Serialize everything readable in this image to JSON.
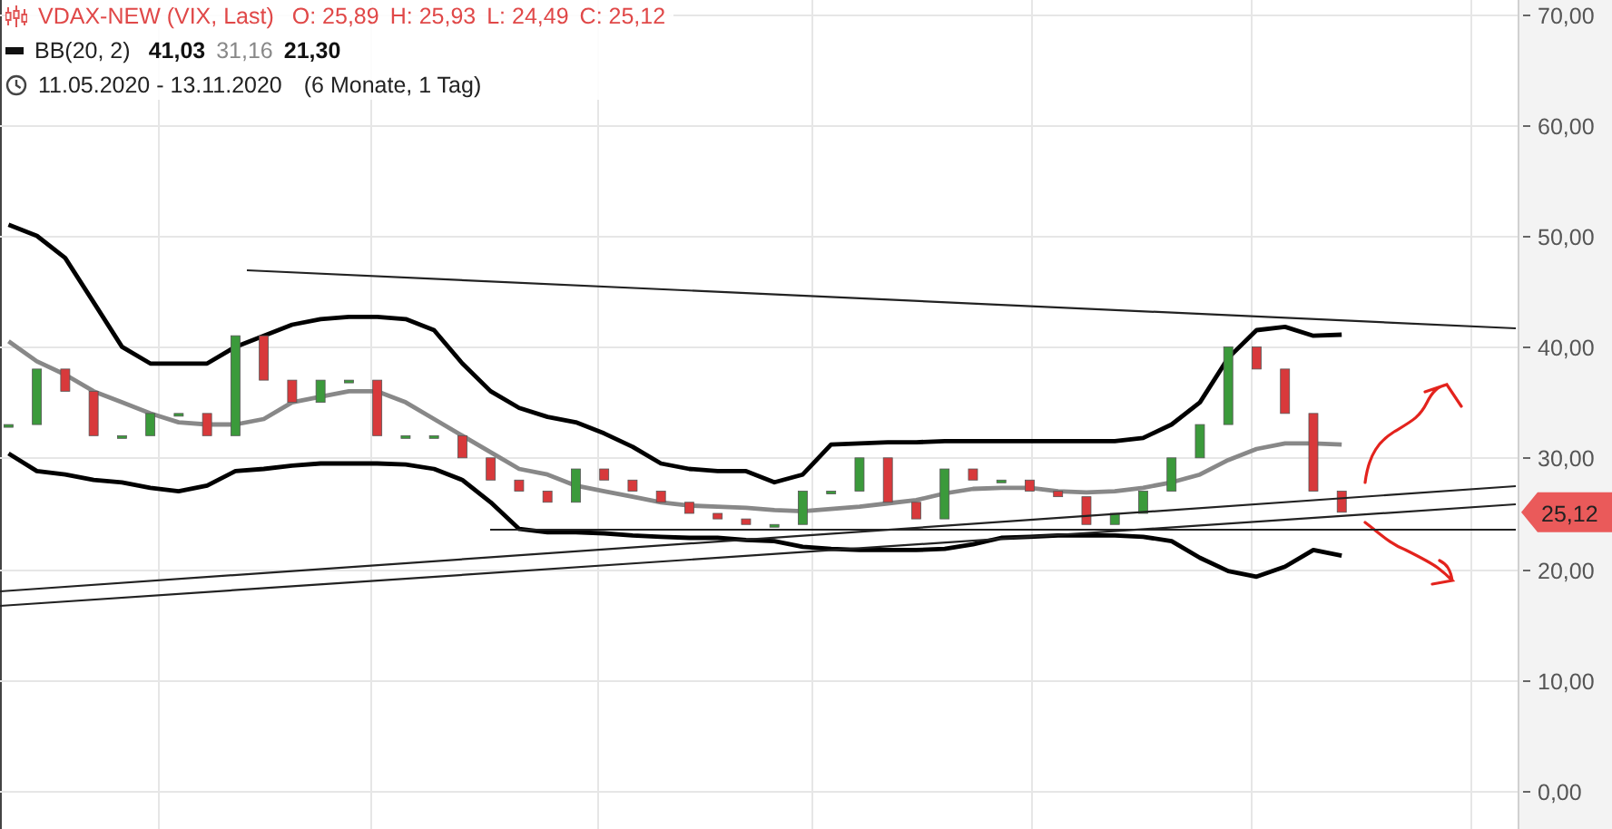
{
  "legend": {
    "instrument": "VDAX-NEW (VIX, Last)",
    "quotes": [
      "O: 25,89",
      "H: 25,93",
      "L: 24,49",
      "C: 25,12"
    ],
    "indicator": {
      "name": "BB(20, 2)",
      "values": [
        {
          "text": "41,03",
          "kind": "band"
        },
        {
          "text": "31,16",
          "kind": "middle"
        },
        {
          "text": "21,30",
          "kind": "band"
        }
      ]
    },
    "period": {
      "range": "11.05.2020 - 13.11.2020",
      "duration": "(6 Monate, 1 Tag)"
    }
  },
  "chart": {
    "last_price": "25,12",
    "chart_data": {
      "type": "line",
      "categories": [
        null,
        null,
        null,
        null,
        null,
        null,
        null,
        null,
        null,
        null,
        null,
        null,
        null,
        null,
        null,
        null,
        null,
        null,
        null,
        null,
        null,
        null,
        null,
        null,
        null,
        null,
        null,
        null,
        null,
        null,
        null,
        null,
        null,
        null,
        null,
        null,
        null,
        null,
        null,
        null,
        null,
        null,
        null,
        null,
        null,
        null,
        null,
        null
      ],
      "ylim": [
        0,
        70
      ],
      "grid": true,
      "yticks": [
        {
          "value": 0,
          "label": "0,00"
        },
        {
          "value": 10,
          "label": "10,00"
        },
        {
          "value": 20,
          "label": "20,00"
        },
        {
          "value": 30,
          "label": "30,00"
        },
        {
          "value": 40,
          "label": "40,00"
        },
        {
          "value": 50,
          "label": "50,00"
        },
        {
          "value": 60,
          "label": "60,00"
        },
        {
          "value": 70,
          "label": "70,00"
        }
      ],
      "series": [
        {
          "color": "#000000",
          "values": [
            51,
            50,
            48,
            44,
            40,
            38.5,
            38.5,
            38.5,
            40,
            41,
            42,
            42.5,
            42.7,
            42.7,
            42.5,
            41.5,
            38.5,
            36,
            34.5,
            33.7,
            33.2,
            32.2,
            31,
            29.5,
            29,
            28.8,
            28.8,
            27.8,
            28.5,
            31.2,
            31.3,
            31.4,
            31.4,
            31.5,
            31.5,
            31.5,
            31.5,
            31.5,
            31.5,
            31.5,
            31.8,
            33,
            35,
            39,
            41.5,
            41.8,
            41,
            41.1
          ]
        },
        {
          "color": "#888888",
          "values": [
            40.5,
            38.7,
            37.5,
            36,
            35,
            34,
            33.2,
            33,
            33,
            33.5,
            35,
            35.5,
            36,
            36,
            35,
            33.5,
            32,
            30.5,
            29,
            28.5,
            27.5,
            27,
            26.5,
            26,
            25.7,
            25.6,
            25.5,
            25.3,
            25.2,
            25.4,
            25.6,
            25.9,
            26.2,
            26.8,
            27.2,
            27.3,
            27.3,
            27,
            26.9,
            27,
            27.3,
            27.8,
            28.5,
            29.8,
            30.8,
            31.3,
            31.3,
            31.2
          ]
        },
        {
          "color": "#000000",
          "values": [
            30.4,
            28.8,
            28.5,
            28,
            27.8,
            27.3,
            27,
            27.5,
            28.8,
            29,
            29.3,
            29.5,
            29.5,
            29.5,
            29.4,
            29,
            28,
            26,
            23.6,
            23.3,
            23.3,
            23.2,
            23,
            22.9,
            22.8,
            22.8,
            22.6,
            22.5,
            22,
            21.8,
            21.7,
            21.7,
            21.7,
            21.8,
            22.2,
            22.8,
            22.9,
            23,
            23,
            23,
            22.9,
            22.5,
            21,
            19.8,
            19.3,
            20.2,
            21.7,
            21.2
          ]
        }
      ]
    }
  }
}
